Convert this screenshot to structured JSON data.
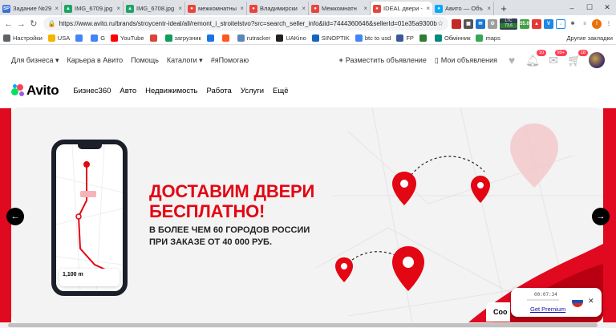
{
  "browser": {
    "tabs": [
      {
        "label": "Задание №29",
        "favicon": "SP",
        "color": "#3b6fd6"
      },
      {
        "label": "IMG_6709.jpg",
        "favicon": "▲",
        "color": "#1fa463"
      },
      {
        "label": "IMG_6708.jpg",
        "favicon": "▲",
        "color": "#1fa463"
      },
      {
        "label": "межкомнатны",
        "favicon": "●",
        "color": "#e8453c"
      },
      {
        "label": "Владимирски",
        "favicon": "●",
        "color": "#e8453c"
      },
      {
        "label": "Межкомнатн",
        "favicon": "●",
        "color": "#e8453c"
      },
      {
        "label": "IDEAL двери -",
        "favicon": "●",
        "color": "#e8453c",
        "active": true
      },
      {
        "label": "Авито — Объ",
        "favicon": "●",
        "color": "#00aaff"
      }
    ],
    "new_tab": "+",
    "url": "https://www.avito.ru/brands/stroycentr-ideal/all/remont_i_stroitelstvo?src=search_seller_info&iid=7444360646&sellerId=01e35a9300b...",
    "ltc": {
      "line1": "LTC",
      "line2": "73.6",
      "line3": "55.0"
    },
    "profile_initial": "I",
    "bookmarks": [
      {
        "label": "Настройки",
        "color": "#5f6368"
      },
      {
        "label": "USA",
        "color": "#f4b400"
      },
      {
        "label": "",
        "color": "#4285f4"
      },
      {
        "label": "G",
        "color": "#4285f4"
      },
      {
        "label": "YouTube",
        "color": "#ff0000"
      },
      {
        "label": "",
        "color": "#db4437"
      },
      {
        "label": "загрузник",
        "color": "#0f9d58"
      },
      {
        "label": "",
        "color": "#1a73e8"
      },
      {
        "label": "",
        "color": "#ff5722"
      },
      {
        "label": "rutracker",
        "color": "#5b87b8"
      },
      {
        "label": "UAKino",
        "color": "#222222"
      },
      {
        "label": "SINOPTIK",
        "color": "#1565c0"
      },
      {
        "label": "btc to usd",
        "color": "#4285f4"
      },
      {
        "label": "FP",
        "color": "#3b5998"
      },
      {
        "label": "",
        "color": "#2e7d32"
      },
      {
        "label": "Обмінник",
        "color": "#00897b"
      },
      {
        "label": "maps",
        "color": "#34a853"
      }
    ],
    "bookmarks_other": "Другие закладки"
  },
  "avito_topnav": {
    "links": [
      "Для бизнеса",
      "Карьера в Авито",
      "Помощь",
      "Каталоги",
      "#яПомогаю"
    ],
    "post_ad": "Разместить объявление",
    "my_ads": "Мои объявления",
    "badges": {
      "notifications": "10",
      "messages": "99+",
      "cart": "18"
    }
  },
  "avito_mainnav": {
    "logo": "Avito",
    "items": [
      "Бизнес360",
      "Авто",
      "Недвижимость",
      "Работа",
      "Услуги",
      "Ещё"
    ]
  },
  "banner": {
    "headline_line1": "ДОСТАВИМ ДВЕРИ",
    "headline_line2": "БЕСПЛАТНО!",
    "sub_line1": "В БОЛЕЕ ЧЕМ 60 ГОРОДОВ РОССИИ",
    "sub_line2": "ПРИ ЗАКАЗЕ ОТ 40 000 РУБ.",
    "phone_distance": "1,100 m"
  },
  "vpn_widget": {
    "timer": "00:07:34",
    "link": "Get Premium"
  },
  "cookie_peek": "Coo"
}
